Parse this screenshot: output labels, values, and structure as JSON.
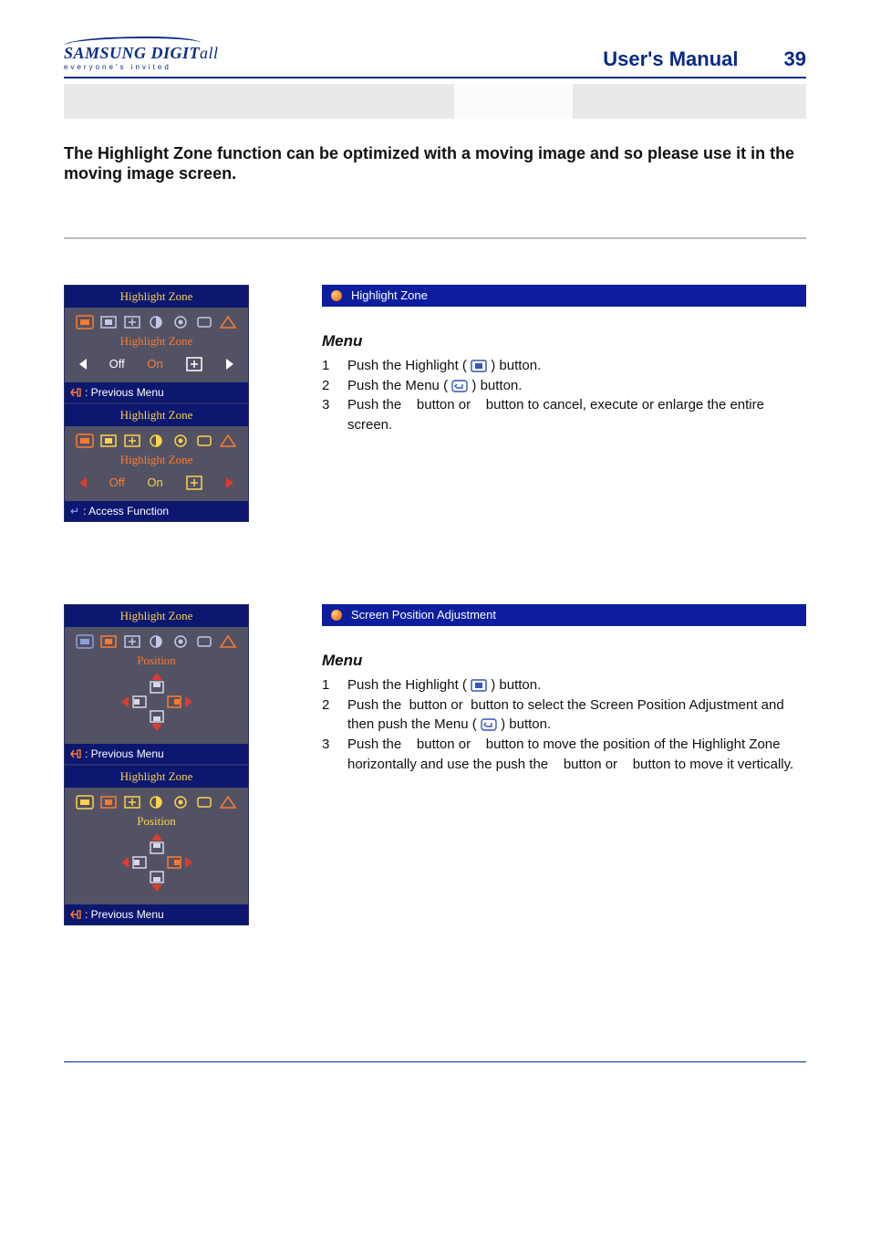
{
  "logo": {
    "brand": "SAMSUNG DIGIT",
    "brandSuffix": "all",
    "tagline": "everyone's invited"
  },
  "header": {
    "title": "User's Manual",
    "page": "39"
  },
  "intro": "The Highlight Zone function can be optimized with a moving image and so please use it in the moving image screen.",
  "osd": {
    "title": "Highlight Zone",
    "subHZ": "Highlight Zone",
    "subPos": "Position",
    "optOff": "Off",
    "optOn": "On",
    "footPrev": ": Previous Menu",
    "footAccess": ": Access Function"
  },
  "sec1": {
    "title": "Highlight Zone",
    "menuHead": "Menu",
    "steps": {
      "s1a": "Push the Highlight (",
      "s1b": ") button.",
      "s2a": "Push the Menu (",
      "s2b": ") button.",
      "s3a": "Push the",
      "s3b": "button or",
      "s3c": "button to cancel, execute or enlarge the entire screen."
    }
  },
  "sec2": {
    "title": "Screen Position Adjustment",
    "menuHead": "Menu",
    "steps": {
      "s1a": "Push the Highlight (",
      "s1b": ") button.",
      "s2a": "Push the",
      "s2b": "button or",
      "s2c": "button to select the Screen Position Adjustment and then push the Menu (",
      "s2d": ") button.",
      "s3a": "Push the",
      "s3b": "button or",
      "s3c": "button to move the position of the Highlight Zone horizontally and use the push the",
      "s3d": "button or",
      "s3e": "button to move it vertically."
    }
  },
  "nums": {
    "n1": "1",
    "n2": "2",
    "n3": "3"
  }
}
